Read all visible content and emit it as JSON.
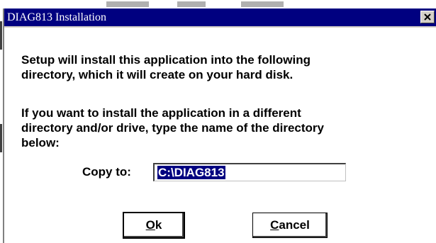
{
  "window": {
    "title": "DIAG813 Installation",
    "close_icon": "close-icon"
  },
  "message": {
    "line1": "Setup will install this application into the following\ndirectory, which it will create on your hard disk.",
    "line2": "If you want to install the application in a different\ndirectory and/or drive, type the name of the directory\nbelow:"
  },
  "copy_to": {
    "label": "Copy to:",
    "value": "C:\\DIAG813"
  },
  "buttons": {
    "ok_mnemonic": "O",
    "ok_rest": "k",
    "cancel_mnemonic": "C",
    "cancel_rest": "ancel"
  },
  "colors": {
    "titlebar": "#000080",
    "selection": "#000080",
    "face": "#ffffff"
  }
}
